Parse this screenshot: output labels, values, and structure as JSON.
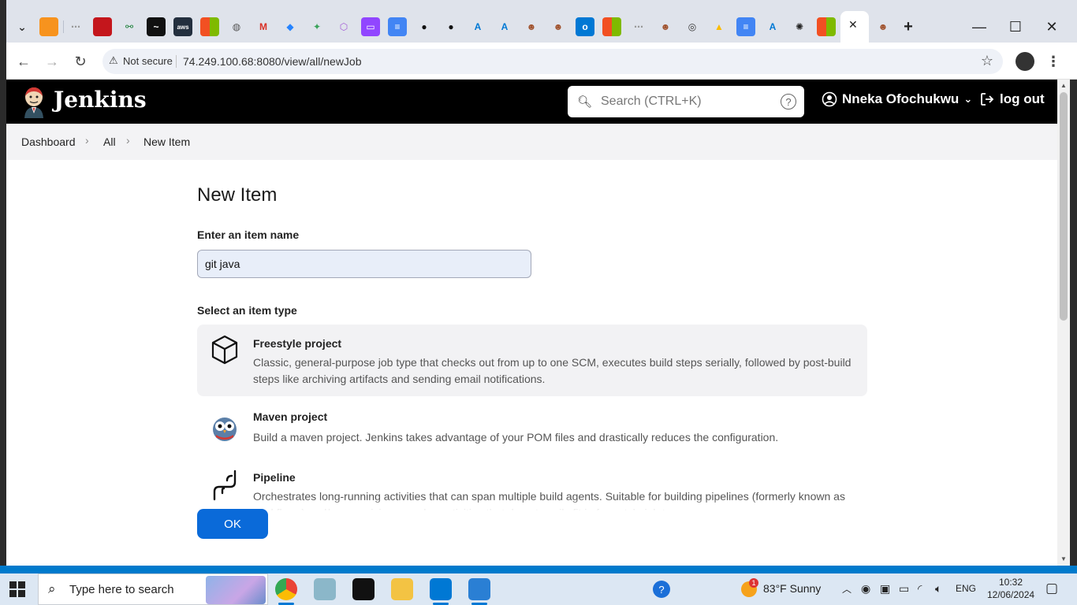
{
  "browser": {
    "tabs_favicon_names": [
      "window-list-icon",
      "box-icon",
      "dots-icon",
      "redbox-icon",
      "gitlab-icon",
      "trend-icon",
      "aws-icon",
      "ms-icon",
      "web-icon",
      "gmail-icon",
      "jira-icon",
      "frog-icon",
      "cube-icon",
      "twitch-icon",
      "docs-icon",
      "github-icon",
      "github2-icon",
      "azure-icon",
      "azure2-icon",
      "avatar-icon",
      "avatar2-icon",
      "outlook-icon",
      "ms2-icon",
      "dots2-icon",
      "avatar3-icon",
      "chrome-icon",
      "drive-icon",
      "docs2-icon",
      "azure3-icon",
      "openai-icon",
      "ms3-icon"
    ],
    "new_tab": "+",
    "minimize": "—",
    "maximize": "☐",
    "close": "✕",
    "omnibox": {
      "security": "Not secure",
      "url": "74.249.100.68:8080/view/all/newJob"
    }
  },
  "jenkins": {
    "brand": "Jenkins",
    "search_placeholder": "Search (CTRL+K)",
    "help": "?",
    "user": "Nneka Ofochukwu",
    "logout": "log out"
  },
  "breadcrumb": [
    "Dashboard",
    "All",
    "New Item"
  ],
  "main": {
    "title": "New Item",
    "name_label": "Enter an item name",
    "name_value": "git java",
    "type_label": "Select an item type",
    "items": [
      {
        "title": "Freestyle project",
        "desc": "Classic, general-purpose job type that checks out from up to one SCM, executes build steps serially, followed by post-build steps like archiving artifacts and sending email notifications.",
        "icon": "cube-icon",
        "selected": true
      },
      {
        "title": "Maven project",
        "desc": "Build a maven project. Jenkins takes advantage of your POM files and drastically reduces the configuration.",
        "icon": "maven-owl-icon",
        "selected": false
      },
      {
        "title": "Pipeline",
        "desc": "Orchestrates long-running activities that can span multiple build agents. Suitable for building pipelines (formerly known as workflows) and/or organizing complex activities that do not easily fit in free-style job type.",
        "icon": "pipeline-icon",
        "selected": false
      }
    ],
    "ok": "OK"
  },
  "taskbar": {
    "search_placeholder": "Type here to search",
    "weather": "83°F  Sunny",
    "weather_badge": "1",
    "lang": "ENG",
    "time": "10:32",
    "date": "12/06/2024"
  },
  "colors": {
    "jenkins_header": "#000000",
    "accent": "#0a6ad9",
    "selected_item_bg": "#f2f2f4"
  }
}
